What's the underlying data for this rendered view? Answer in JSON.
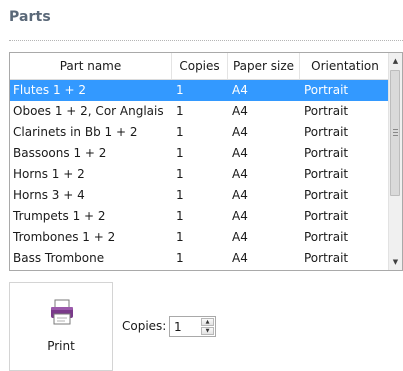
{
  "section": {
    "title": "Parts"
  },
  "table": {
    "columns": [
      "Part name",
      "Copies",
      "Paper size",
      "Orientation"
    ],
    "selected_index": 0,
    "rows": [
      [
        "Flutes 1 + 2",
        "1",
        "A4",
        "Portrait"
      ],
      [
        "Oboes 1 + 2, Cor Anglais",
        "1",
        "A4",
        "Portrait"
      ],
      [
        "Clarinets in Bb 1 + 2",
        "1",
        "A4",
        "Portrait"
      ],
      [
        "Bassoons 1 + 2",
        "1",
        "A4",
        "Portrait"
      ],
      [
        "Horns 1 + 2",
        "1",
        "A4",
        "Portrait"
      ],
      [
        "Horns 3 + 4",
        "1",
        "A4",
        "Portrait"
      ],
      [
        "Trumpets 1 + 2",
        "1",
        "A4",
        "Portrait"
      ],
      [
        "Trombones 1 + 2",
        "1",
        "A4",
        "Portrait"
      ],
      [
        "Bass Trombone",
        "1",
        "A4",
        "Portrait"
      ]
    ],
    "scrollbar": {
      "up_icon": "▲",
      "down_icon": "▼"
    }
  },
  "print": {
    "label": "Print",
    "icon": "printer-icon"
  },
  "copies": {
    "label": "Copies:",
    "value": "1"
  },
  "colors": {
    "selection": "#3399ff",
    "title": "#5a6878",
    "printer": "#7a3a8a"
  }
}
